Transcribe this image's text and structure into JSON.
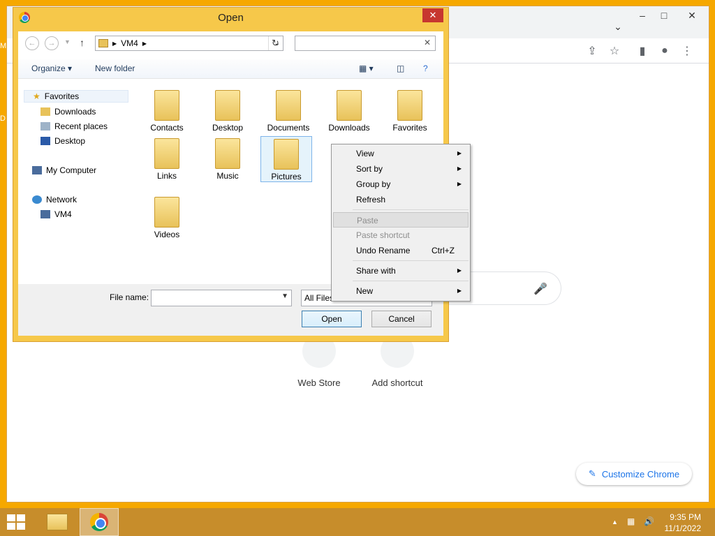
{
  "desktop": {
    "label_top": "M",
    "label_mid": "D"
  },
  "chrome": {
    "win_controls": [
      "–",
      "□",
      "✕"
    ],
    "tab_dropdown": "⌄",
    "toolbar_icons": [
      "share-icon",
      "star-icon",
      "side-panel-icon",
      "profile-icon",
      "menu-icon"
    ],
    "shortcuts": [
      {
        "label": "Web Store"
      },
      {
        "label": "Add shortcut"
      }
    ],
    "customize_label": "Customize Chrome"
  },
  "dialog": {
    "title": "Open",
    "close_symbol": "✕",
    "address_path": "VM4",
    "search_placeholder": "",
    "organize_label": "Organize",
    "new_folder_label": "New folder",
    "nav": {
      "favorites": "Favorites",
      "downloads": "Downloads",
      "recent": "Recent places",
      "desktop": "Desktop",
      "my_computer": "My Computer",
      "network": "Network",
      "vm4": "VM4"
    },
    "folders": [
      "Contacts",
      "Desktop",
      "Documents",
      "Downloads",
      "Favorites",
      "Links",
      "Music",
      "Pictures",
      "Videos"
    ],
    "file_name_label": "File name:",
    "file_name_value": "",
    "filter_label": "All Files",
    "open_label": "Open",
    "cancel_label": "Cancel"
  },
  "context_menu": {
    "view": "View",
    "sort_by": "Sort by",
    "group_by": "Group by",
    "refresh": "Refresh",
    "paste": "Paste",
    "paste_shortcut": "Paste shortcut",
    "undo_rename": "Undo Rename",
    "undo_shortcut": "Ctrl+Z",
    "share_with": "Share with",
    "new": "New"
  },
  "taskbar": {
    "time": "9:35 PM",
    "date": "11/1/2022"
  },
  "colors": {
    "desktop": "#f6a800",
    "dialog_frame": "#f6c84a",
    "taskbar": "#c78d2b",
    "chrome_accent": "#1a73e8"
  }
}
